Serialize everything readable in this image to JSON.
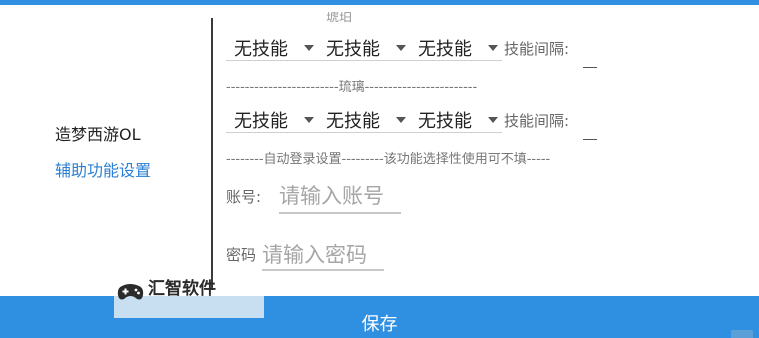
{
  "sidebar": {
    "title": "造梦西游OL",
    "link": "辅助功能设置"
  },
  "truncated_heading": "琥珀",
  "skill_rows": [
    {
      "selects": [
        "无技能",
        "无技能",
        "无技能"
      ],
      "interval_label": "技能间隔:"
    },
    {
      "selects": [
        "无技能",
        "无技能",
        "无技能"
      ],
      "interval_label": "技能间隔:"
    }
  ],
  "sections": {
    "liuli": "------------------------琉璃------------------------",
    "autologin": "--------自动登录设置---------该功能选择性使用可不填-----"
  },
  "account": {
    "label": "账号:",
    "placeholder": "请输入账号"
  },
  "password": {
    "label": "密码",
    "placeholder": "请输入密码"
  },
  "save_label": "保存",
  "watermark": "汇智软件",
  "colors": {
    "accent": "#2f8fe0",
    "link": "#2a7fd4"
  }
}
